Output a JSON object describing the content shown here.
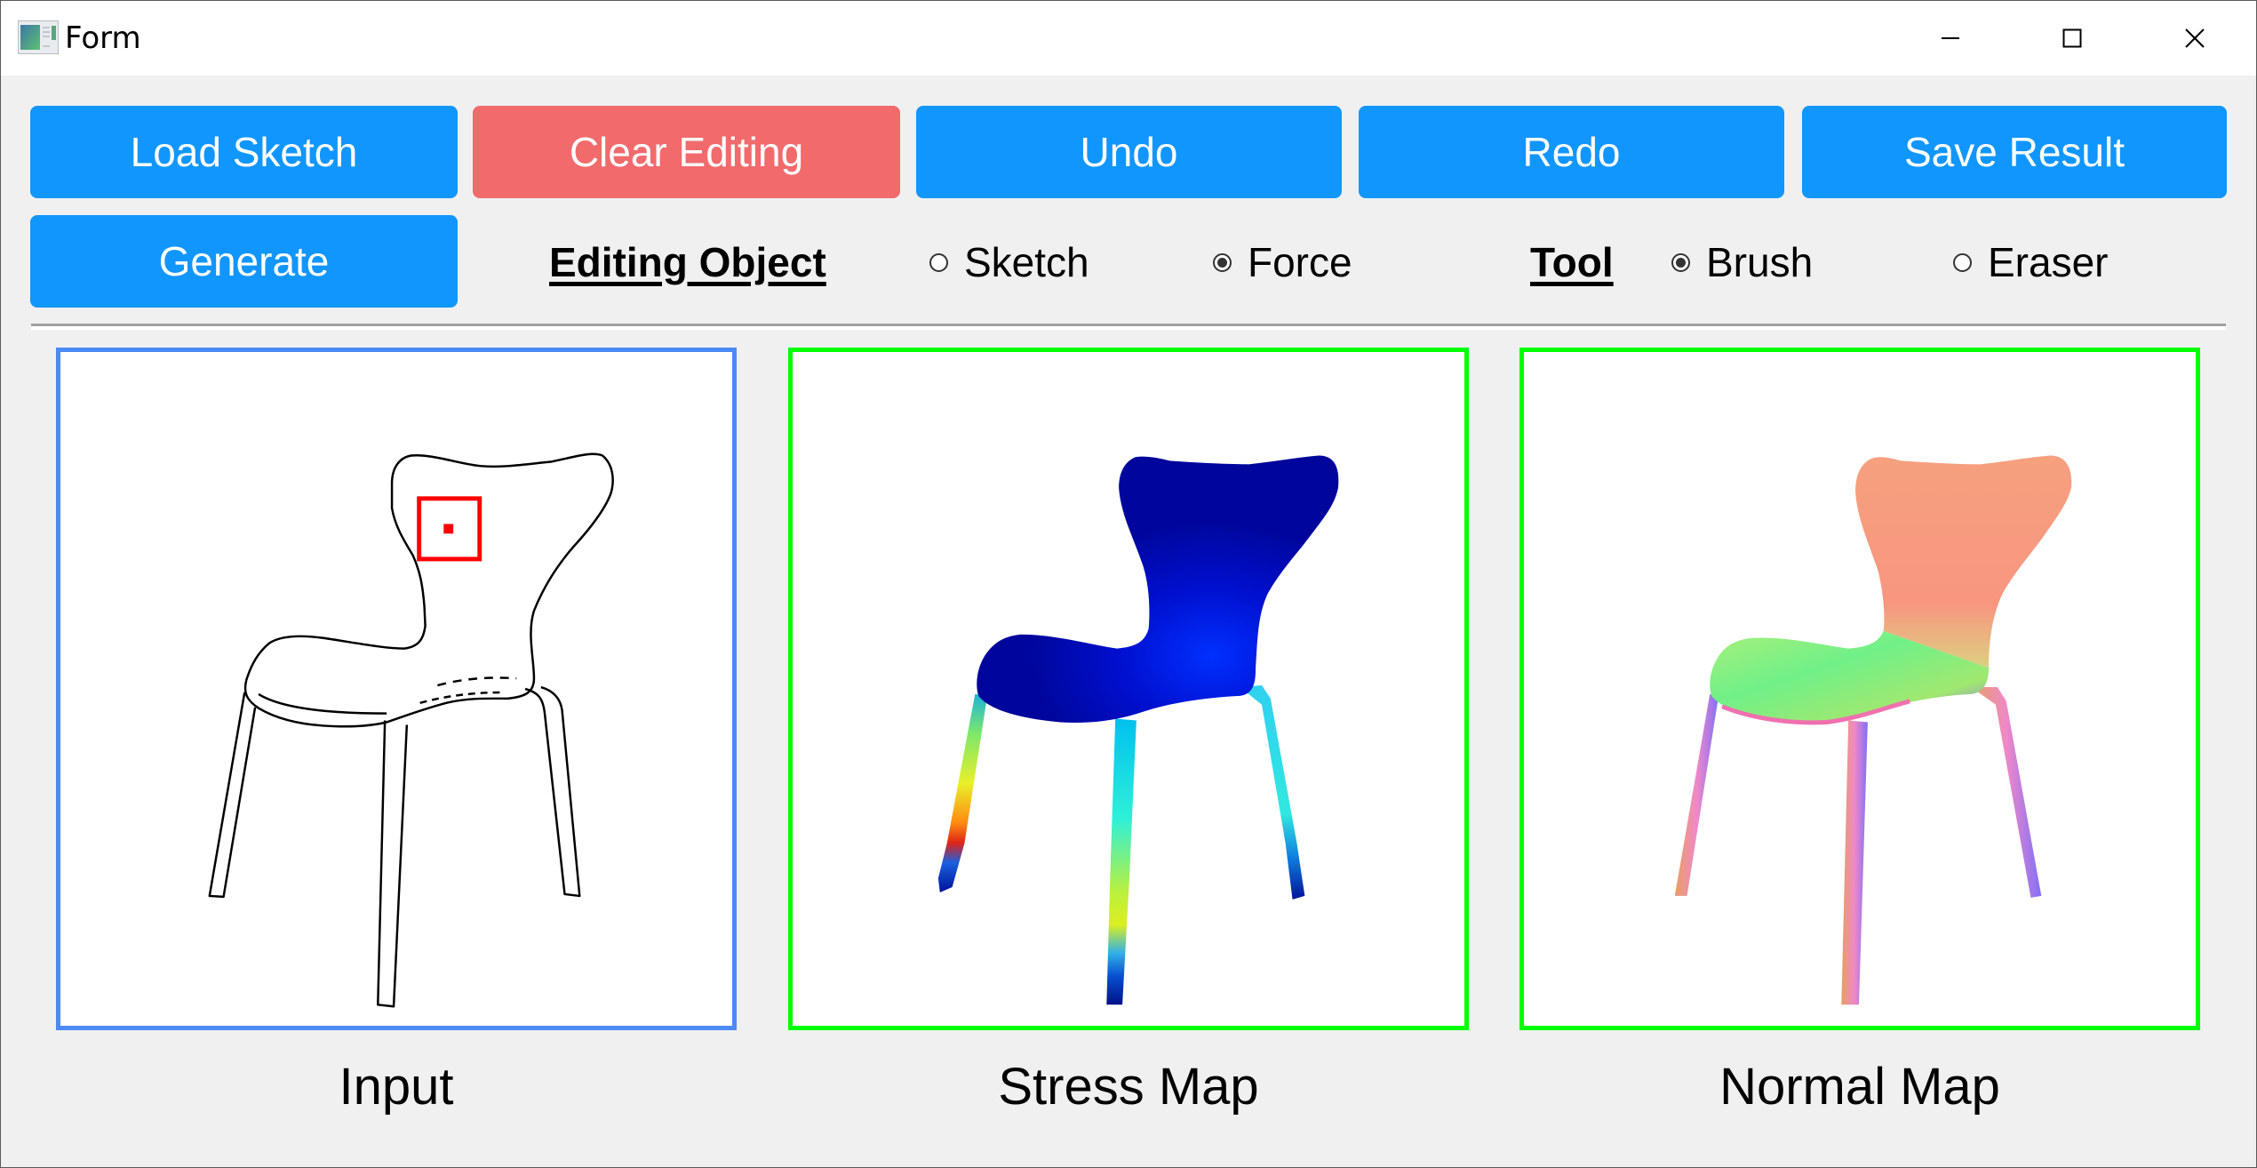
{
  "window": {
    "title": "Form",
    "app_icon": "form-window-icon",
    "controls": {
      "minimize_icon": "minimize-icon",
      "maximize_icon": "maximize-icon",
      "close_icon": "close-icon"
    }
  },
  "toolbar": {
    "row1": [
      {
        "label": "Load Sketch",
        "color": "#1196fe"
      },
      {
        "label": "Clear Editing",
        "color": "#f16a6c"
      },
      {
        "label": "Undo",
        "color": "#1196fe"
      },
      {
        "label": "Redo",
        "color": "#1196fe"
      },
      {
        "label": "Save Result",
        "color": "#1196fe"
      }
    ],
    "generate_label": "Generate"
  },
  "editing_object": {
    "label": "Editing Object",
    "options": [
      {
        "label": "Sketch",
        "checked": false
      },
      {
        "label": "Force",
        "checked": true
      }
    ]
  },
  "tool": {
    "label": "Tool",
    "options": [
      {
        "label": "Brush",
        "checked": true
      },
      {
        "label": "Eraser",
        "checked": false
      }
    ]
  },
  "panels": [
    {
      "label": "Input",
      "border_color": "#4a8af4",
      "content": "chair-sketch-with-force-marker"
    },
    {
      "label": "Stress Map",
      "border_color": "#00ff00",
      "content": "chair-stress-heatmap"
    },
    {
      "label": "Normal Map",
      "border_color": "#00ff00",
      "content": "chair-normal-map"
    }
  ],
  "colors": {
    "primary_button": "#1196fe",
    "danger_button": "#f16a6c",
    "input_border": "#4a8af4",
    "output_border": "#00ff00",
    "force_marker": "#ff0000"
  }
}
